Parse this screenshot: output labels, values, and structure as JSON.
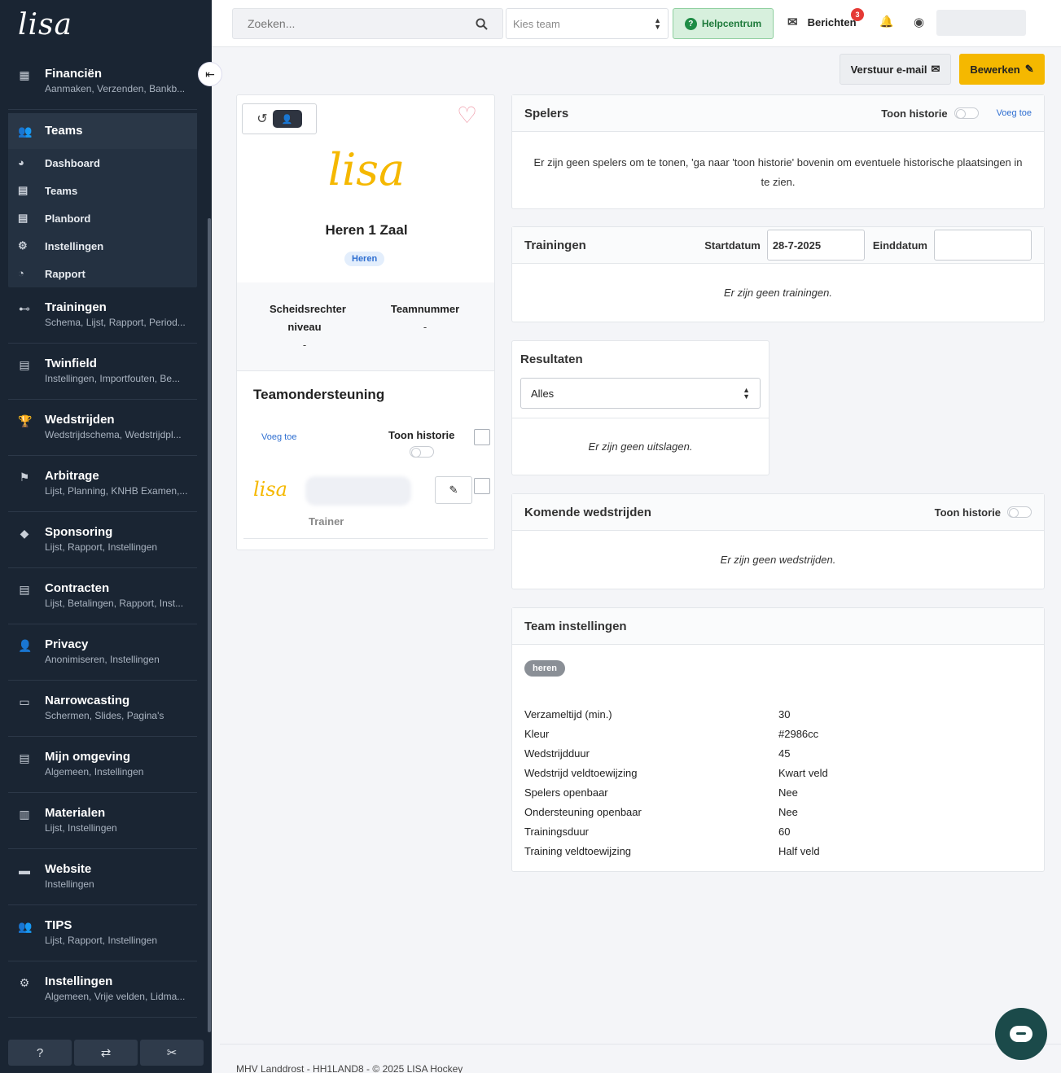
{
  "brand": {
    "logo_text": "lisa"
  },
  "sidebar": {
    "items_before": [
      {
        "title": "Financiën",
        "sub": "Aanmaken, Verzenden, Bankb...",
        "icon": "calculator-icon",
        "glyph": "▦"
      }
    ],
    "teams": {
      "title": "Teams",
      "icon_glyph": "👥",
      "sub_items": [
        {
          "label": "Dashboard",
          "glyph": "◕"
        },
        {
          "label": "Teams",
          "glyph": "▤"
        },
        {
          "label": "Planbord",
          "glyph": "▤"
        },
        {
          "label": "Instellingen",
          "glyph": "⚙"
        },
        {
          "label": "Rapport",
          "glyph": "◔"
        }
      ]
    },
    "items_after": [
      {
        "title": "Trainingen",
        "sub": "Schema, Lijst, Rapport, Period...",
        "glyph": "⊷"
      },
      {
        "title": "Twinfield",
        "sub": "Instellingen, Importfouten, Be...",
        "glyph": "▤"
      },
      {
        "title": "Wedstrijden",
        "sub": "Wedstrijdschema, Wedstrijdpl...",
        "glyph": "🏆"
      },
      {
        "title": "Arbitrage",
        "sub": "Lijst, Planning, KNHB Examen,...",
        "glyph": "⚑"
      },
      {
        "title": "Sponsoring",
        "sub": "Lijst, Rapport, Instellingen",
        "glyph": "◆"
      },
      {
        "title": "Contracten",
        "sub": "Lijst, Betalingen, Rapport, Inst...",
        "glyph": "▤"
      },
      {
        "title": "Privacy",
        "sub": "Anonimiseren, Instellingen",
        "glyph": "👤"
      },
      {
        "title": "Narrowcasting",
        "sub": "Schermen, Slides, Pagina's",
        "glyph": "▭"
      },
      {
        "title": "Mijn omgeving",
        "sub": "Algemeen, Instellingen",
        "glyph": "▤"
      },
      {
        "title": "Materialen",
        "sub": "Lijst, Instellingen",
        "glyph": "▥"
      },
      {
        "title": "Website",
        "sub": "Instellingen",
        "glyph": "▬"
      },
      {
        "title": "TIPS",
        "sub": "Lijst, Rapport, Instellingen",
        "glyph": "👥"
      },
      {
        "title": "Instellingen",
        "sub": "Algemeen, Vrije velden, Lidma...",
        "glyph": "⚙"
      }
    ],
    "bottom_buttons": [
      "?",
      "⇄",
      "✂"
    ]
  },
  "topbar": {
    "search_placeholder": "Zoeken...",
    "team_select_placeholder": "Kies team",
    "help_label": "Helpcentrum",
    "messages_label": "Berichten",
    "messages_count": "3"
  },
  "actions": {
    "email_label": "Verstuur e-mail",
    "edit_label": "Bewerken"
  },
  "team": {
    "logo_text": "lisa",
    "name": "Heren 1 Zaal",
    "tag": "Heren",
    "referee_label": "Scheidsrechter niveau",
    "referee_value": "-",
    "number_label": "Teamnummer",
    "number_value": "-",
    "support_title": "Teamondersteuning",
    "support_add": "Voeg toe",
    "support_history": "Toon historie",
    "support_logo": "lisa",
    "support_role": "Trainer"
  },
  "spelers": {
    "title": "Spelers",
    "history_label": "Toon historie",
    "add_label": "Voeg toe",
    "empty": "Er zijn geen spelers om te tonen, 'ga naar 'toon historie' bovenin om eventuele historische plaatsingen in te zien."
  },
  "trainingen": {
    "title": "Trainingen",
    "start_label": "Startdatum",
    "start_value": "28-7-2025",
    "end_label": "Einddatum",
    "end_value": "",
    "empty": "Er zijn geen trainingen."
  },
  "resultaten": {
    "title": "Resultaten",
    "select_value": "Alles",
    "empty": "Er zijn geen uitslagen."
  },
  "komende": {
    "title": "Komende wedstrijden",
    "history_label": "Toon historie",
    "empty": "Er zijn geen wedstrijden."
  },
  "team_settings": {
    "title": "Team instellingen",
    "tag": "heren",
    "rows": [
      {
        "key": "Verzameltijd (min.)",
        "value": "30"
      },
      {
        "key": "Kleur",
        "value": "#2986cc"
      },
      {
        "key": "Wedstrijdduur",
        "value": "45"
      },
      {
        "key": "Wedstrijd veldtoewijzing",
        "value": "Kwart veld"
      },
      {
        "key": "Spelers openbaar",
        "value": "Nee"
      },
      {
        "key": "Ondersteuning openbaar",
        "value": "Nee"
      },
      {
        "key": "Trainingsduur",
        "value": "60"
      },
      {
        "key": "Training veldtoewijzing",
        "value": "Half veld"
      }
    ]
  },
  "footer": {
    "text": "MHV Landdrost - HH1LAND8 - © 2025 LISA Hockey"
  },
  "colors": {
    "accent": "#f5b800",
    "sidebar": "#1a2533",
    "link": "#2f6fd1",
    "help_green": "#1e8c45"
  }
}
